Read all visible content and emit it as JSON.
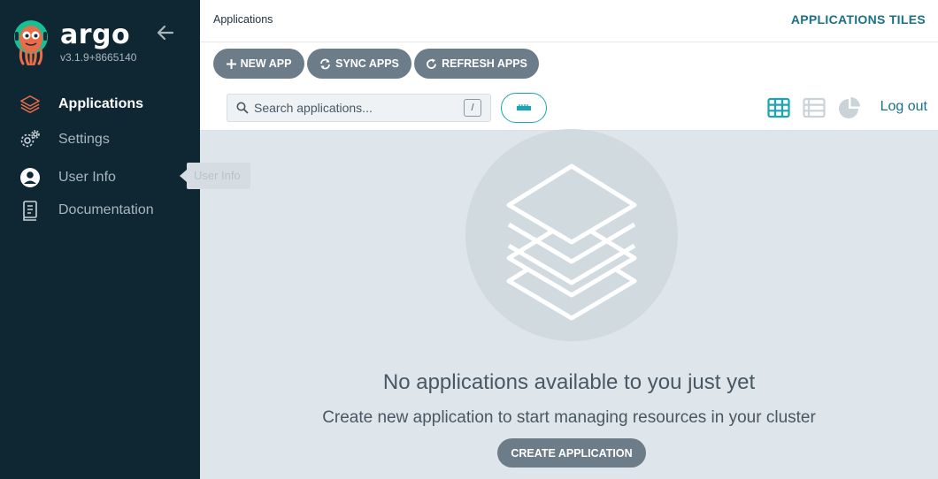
{
  "sidebar": {
    "brand": "argo",
    "version": "v3.1.9+8665140",
    "items": [
      {
        "label": "Applications",
        "icon": "layers-icon",
        "active": true
      },
      {
        "label": "Settings",
        "icon": "gears-icon",
        "active": false
      },
      {
        "label": "User Info",
        "icon": "user-circle-icon",
        "active": false
      },
      {
        "label": "Documentation",
        "icon": "book-icon",
        "active": false
      }
    ],
    "tooltip": "User Info"
  },
  "header": {
    "breadcrumb": "Applications",
    "title": "APPLICATIONS TILES"
  },
  "toolbar": {
    "new_app": "NEW APP",
    "sync_apps": "SYNC APPS",
    "refresh_apps": "REFRESH APPS"
  },
  "search": {
    "placeholder": "Search applications...",
    "shortcut": "/"
  },
  "view": {
    "logout": "Log out",
    "active_view": "tiles"
  },
  "empty": {
    "title": "No applications available to you just yet",
    "subtitle": "Create new application to start managing resources in your cluster",
    "create_button": "CREATE APPLICATION"
  },
  "colors": {
    "sidebar_bg": "#0f2733",
    "accent": "#1ba3b6",
    "button_bg": "#6c7d89",
    "brand_orange": "#e96d49"
  }
}
